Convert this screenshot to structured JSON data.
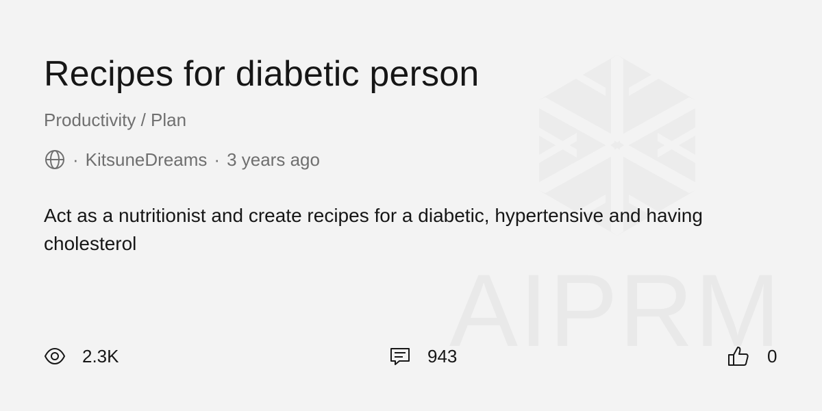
{
  "prompt": {
    "title": "Recipes for diabetic person",
    "category": "Productivity / Plan",
    "author": "KitsuneDreams",
    "age": "3 years ago",
    "separator": "·",
    "description": "Act as a nutritionist and create recipes for a diabetic, hypertensive and having cholesterol"
  },
  "stats": {
    "views": "2.3K",
    "comments": "943",
    "likes": "0"
  },
  "watermark": {
    "text": "AIPRM"
  },
  "icons": {
    "visibility": "globe-icon",
    "views": "eye-icon",
    "comments": "comment-icon",
    "likes": "thumbs-up-icon",
    "logo": "aiprm-logo-icon"
  },
  "colors": {
    "background": "#f3f3f3",
    "title": "#161616",
    "muted": "#6f6f6f",
    "watermark": "#e9e9e9"
  }
}
